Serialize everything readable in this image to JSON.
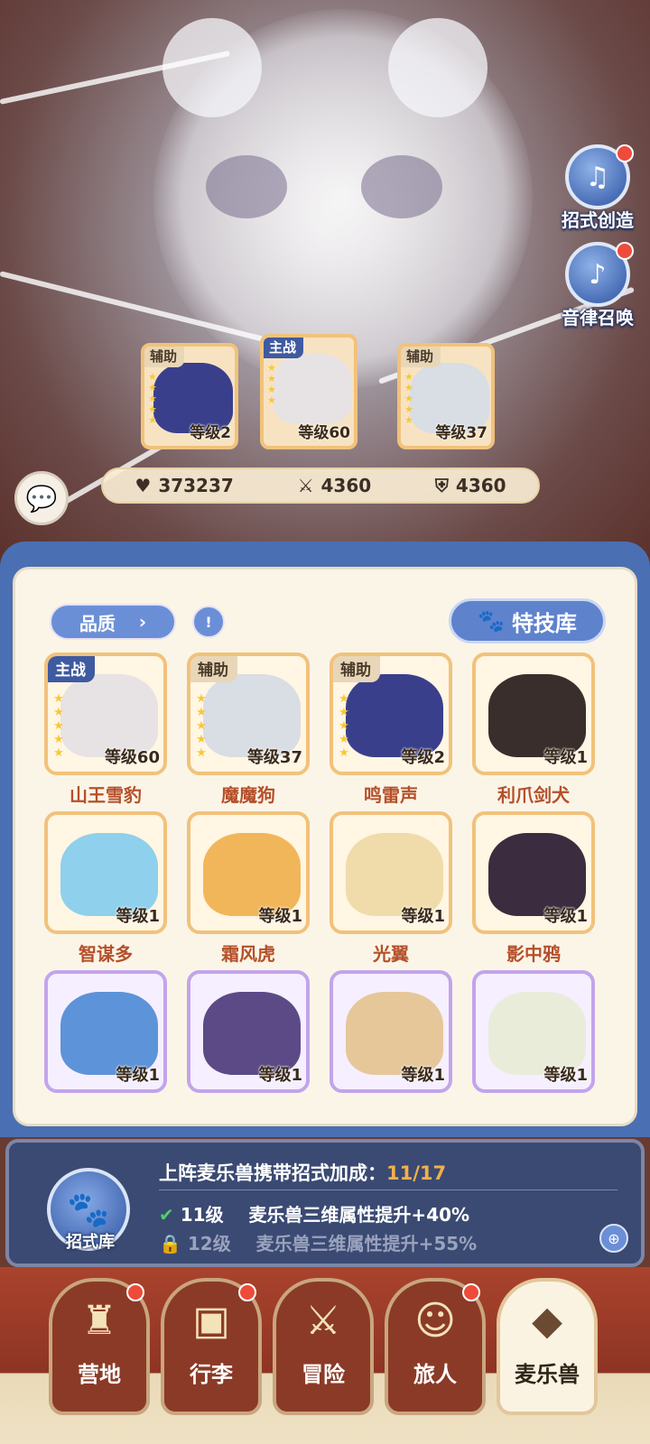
{
  "side_buttons": [
    {
      "label": "招式创造",
      "icon": "skill-create-icon",
      "badge": true
    },
    {
      "label": "音律召唤",
      "icon": "music-summon-icon",
      "badge": true
    }
  ],
  "team": [
    {
      "tag": "辅助",
      "level": "等级2",
      "stars": 5
    },
    {
      "tag": "主战",
      "level": "等级60",
      "stars": 4
    },
    {
      "tag": "辅助",
      "level": "等级37",
      "stars": 5
    }
  ],
  "stats": {
    "hp": "373237",
    "attack": "4360",
    "defense": "4360"
  },
  "filter": {
    "label": "品质",
    "skill_library": "特技库"
  },
  "creatures": [
    {
      "name": "山王雪豹",
      "tag": "主战",
      "level": "等级60",
      "frame": "gold",
      "color": "#e7e3e4"
    },
    {
      "name": "魔魔狗",
      "tag": "辅助",
      "level": "等级37",
      "frame": "gold",
      "color": "#d9dde4"
    },
    {
      "name": "鸣雷声",
      "tag": "辅助",
      "level": "等级2",
      "frame": "gold",
      "color": "#3a3f8c"
    },
    {
      "name": "利爪剑犬",
      "tag": "",
      "level": "等级1",
      "frame": "gold",
      "color": "#3a2e2c"
    },
    {
      "name": "智谋多",
      "tag": "",
      "level": "等级1",
      "frame": "gold",
      "color": "#8fd0ec"
    },
    {
      "name": "霜风虎",
      "tag": "",
      "level": "等级1",
      "frame": "gold",
      "color": "#f2b65a"
    },
    {
      "name": "光翼",
      "tag": "",
      "level": "等级1",
      "frame": "gold",
      "color": "#f0dcaa"
    },
    {
      "name": "影中鸦",
      "tag": "",
      "level": "等级1",
      "frame": "gold",
      "color": "#3c2c3f"
    },
    {
      "name": "",
      "tag": "",
      "level": "等级1",
      "frame": "purple",
      "color": "#5d93d8"
    },
    {
      "name": "",
      "tag": "",
      "level": "等级1",
      "frame": "purple",
      "color": "#5b4a86"
    },
    {
      "name": "",
      "tag": "",
      "level": "等级1",
      "frame": "purple",
      "color": "#e6c79a"
    },
    {
      "name": "",
      "tag": "",
      "level": "等级1",
      "frame": "purple",
      "color": "#e9ecd9"
    }
  ],
  "bonus": {
    "library_label": "招式库",
    "title": "上阵麦乐兽携带招式加成：",
    "count": "11/17",
    "rows": [
      {
        "level": "11级",
        "text": "麦乐兽三维属性提升+40%",
        "unlocked": true
      },
      {
        "level": "12级",
        "text": "麦乐兽三维属性提升+55%",
        "unlocked": false
      }
    ]
  },
  "nav": [
    {
      "label": "营地",
      "icon": "castle-icon",
      "badge": true,
      "active": false
    },
    {
      "label": "行李",
      "icon": "luggage-icon",
      "badge": true,
      "active": false
    },
    {
      "label": "冒险",
      "icon": "crossed-swords-icon",
      "badge": false,
      "active": false
    },
    {
      "label": "旅人",
      "icon": "traveler-icon",
      "badge": true,
      "active": false
    },
    {
      "label": "麦乐兽",
      "icon": "creature-icon",
      "badge": false,
      "active": true
    }
  ]
}
